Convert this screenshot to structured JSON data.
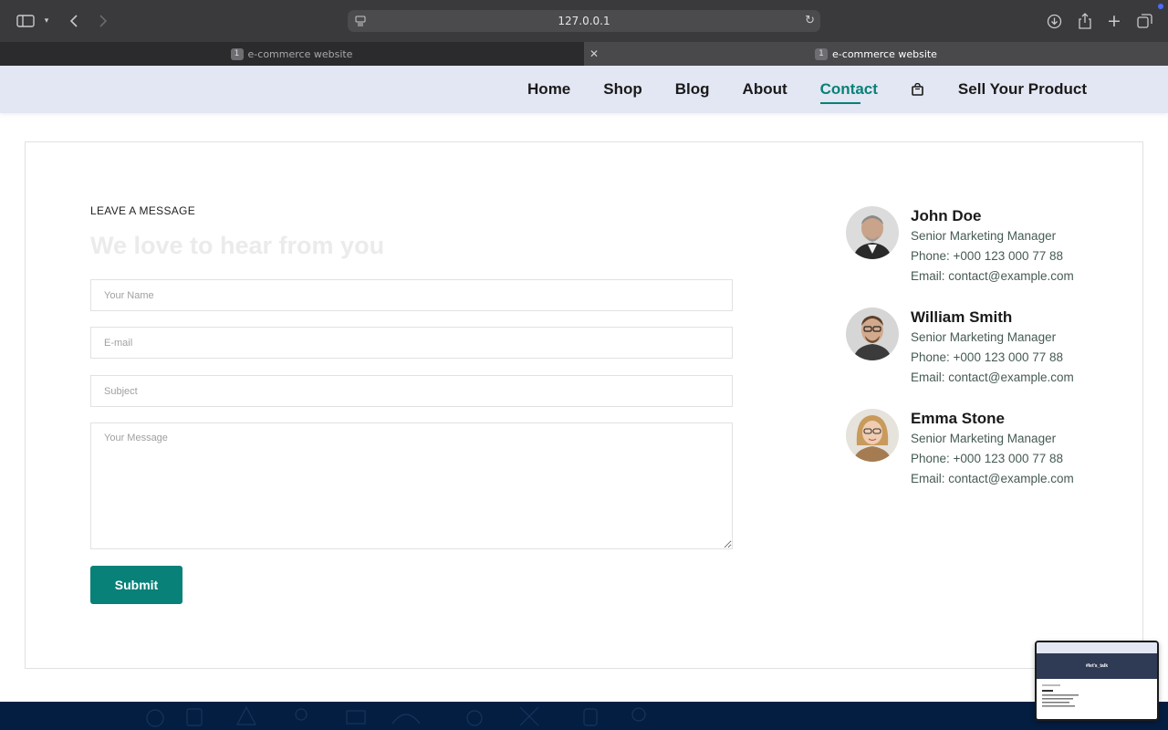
{
  "browser": {
    "url": "127.0.0.1",
    "tabs": [
      {
        "badge": "1",
        "title": "e-commerce website",
        "active": false
      },
      {
        "badge": "1",
        "title": "e-commerce website",
        "active": true
      }
    ]
  },
  "nav": {
    "items": [
      {
        "label": "Home",
        "active": false
      },
      {
        "label": "Shop",
        "active": false
      },
      {
        "label": "Blog",
        "active": false
      },
      {
        "label": "About",
        "active": false
      },
      {
        "label": "Contact",
        "active": true
      },
      {
        "label": "Sell Your Product",
        "active": false
      }
    ],
    "cart_icon": "shopping-bag-icon",
    "accent_color": "#088178"
  },
  "form": {
    "eyebrow": "LEAVE A MESSAGE",
    "headline": "We love to hear from you",
    "name_placeholder": "Your Name",
    "email_placeholder": "E-mail",
    "subject_placeholder": "Subject",
    "message_placeholder": "Your Message",
    "submit_label": "Submit"
  },
  "contacts": [
    {
      "name": "John Doe",
      "role": "Senior Marketing Manager",
      "phone": "Phone: +000 123 000 77 88",
      "email": "Email: contact@example.com"
    },
    {
      "name": "William Smith",
      "role": "Senior Marketing Manager",
      "phone": "Phone: +000 123 000 77 88",
      "email": "Email: contact@example.com"
    },
    {
      "name": "Emma Stone",
      "role": "Senior Marketing Manager",
      "phone": "Phone: +000 123 000 77 88",
      "email": "Email: contact@example.com"
    }
  ],
  "thumbnail": {
    "hero_text": "#let's_talk"
  }
}
